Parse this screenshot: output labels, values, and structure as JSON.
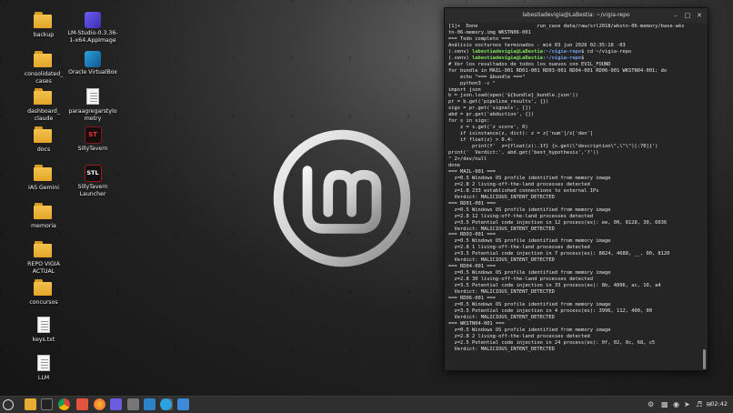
{
  "desktop": {
    "icons": [
      {
        "label": "backup",
        "icon": "folder-icon"
      },
      {
        "label": "consolidated_\ncases",
        "icon": "folder-icon"
      },
      {
        "label": "dashboard_\nclaude",
        "icon": "folder-icon"
      },
      {
        "label": "docs",
        "icon": "folder-icon"
      },
      {
        "label": "IAS Gemini",
        "icon": "folder-icon"
      },
      {
        "label": "memoria",
        "icon": "folder-icon"
      },
      {
        "label": "REPO VIGIA\nACTUAL",
        "icon": "folder-icon"
      },
      {
        "label": "concursos",
        "icon": "folder-icon"
      },
      {
        "label": "keys.txt",
        "icon": "text-file-icon"
      },
      {
        "label": "LLM",
        "icon": "shortcut-icon"
      },
      {
        "label": "LM-Studio-0.3.36-\n1-x64.AppImage",
        "icon": "lmstudio-icon"
      },
      {
        "label": "Oracle VirtualBox",
        "icon": "virtualbox-icon"
      },
      {
        "label": "paraagregarstylo\nmetry",
        "icon": "text-file-icon"
      },
      {
        "label": "SillyTavern",
        "icon": "sillytavern-icon"
      },
      {
        "label": "SillyTavern\nLauncher",
        "icon": "sillytavern-launcher-icon"
      }
    ]
  },
  "terminal": {
    "title": "labestiadevigia@LaBestia: ~/vigia-repo",
    "prompt_user": "labestiadevigia@LaBestia",
    "prompt_path": ":~/vigia-repo",
    "lines": [
      "[1]+  Done                    run_case data/raw/srl2018/wkstn-06-memory/base-wks",
      "tn-06-memory.img WKSTN06-001",
      "=== Todo completo ===",
      "Análisis nocturnos terminados - mié 03 jun 2026 02:35:18 -03",
      "",
      "",
      "# Ver los resultados de todos los nuevos con EVIL_FOUND",
      "for bundle in MAIL-001 RD01-001 RD03-001 RD04-001 RD06-001 WKSTN04-001; do",
      "    echo \"=== $bundle ===\"",
      "    python3 -c \"",
      "import json",
      "b = json.load(open('${bundle}_bundle.json'))",
      "pr = b.get('pipeline_results', {})",
      "sigs = pr.get('signals', [])",
      "abd = pr.get('abduction', {})",
      "for s in sigs:",
      "    z = s.get('z_score', 0)",
      "    if isinstance(z, dict): z = z['num']/z['den']",
      "    if float(z) > 0.4:",
      "        print(f'  z={float(z):.1f} {s.get(\\\"description\\\",\\\"\\\")[:70]}')",
      "print('  Verdict:', abd.get('best_hypothesis','?'))",
      "\" 2>/dev/null",
      "done",
      "=== MAIL-001 ===",
      "  z=0.5 Windows OS profile identified from memory image",
      "  z=2.8 2 living-off-the-land processes detected",
      "  z=1.8 233 established connections to external IPs",
      "  Verdict: MALICIOUS_INTENT_DETECTED",
      "=== RD01-001 ===",
      "  z=0.5 Windows OS profile identified from memory image",
      "  z=2.8 12 living-off-the-land processes detected",
      "  z=3.5 Potential code injection in 12 process(es): ee, 00, 8128, 30, 6036",
      "  Verdict: MALICIOUS_INTENT_DETECTED",
      "=== RD03-001 ===",
      "  z=0.5 Windows OS profile identified from memory image",
      "  z=2.8 1 living-off-the-land processes detected",
      "  z=3.5 Potential code injection in 7 process(es): 8824, 4688, __, 00, 8120",
      "  Verdict: MALICIOUS_INTENT_DETECTED",
      "=== RD04-001 ===",
      "  z=0.5 Windows OS profile identified from memory image",
      "  z=2.8 30 living-off-the-land processes detected",
      "  z=3.5 Potential code injection in 33 process(es): 8b, 4896, ac, 10, a4",
      "  Verdict: MALICIOUS_INTENT_DETECTED",
      "=== RD06-001 ===",
      "  z=0.5 Windows OS profile identified from memory image",
      "  z=3.5 Potential code injection in 4 process(es): 3996, 112, 400, 00",
      "  Verdict: MALICIOUS_INTENT_DETECTED",
      "=== WKSTN04-001 ===",
      "  z=0.5 Windows OS profile identified from memory image",
      "  z=2.8 2 living-off-the-land processes detected",
      "  z=2.5 Potential code injection in 24 process(es): 0f, 02, 0c, 68, c5",
      "  Verdict: MALICIOUS_INTENT_DETECTED",
      ""
    ],
    "prompt_lines": {
      "4": {
        "prefix": "(.venv) ",
        "cmd": "$ cd ~/vigia-repo"
      },
      "5": {
        "prefix": "(.venv) ",
        "cmd": "$ "
      },
      "54": {
        "prefix": "(.venv) ",
        "cmd": "$ "
      }
    }
  },
  "taskbar": {
    "apps": [
      "mint-menu-icon",
      "files-icon",
      "terminal-badge-icon",
      "chrome-icon",
      "brave-icon",
      "firefox-icon",
      "lmstudio-icon",
      "chromium-icon",
      "virtualbox-icon",
      "screenshot-icon",
      "telegram-icon",
      "notes-icon"
    ],
    "clock": "02:42"
  },
  "colors": {
    "prompt_user": "#7ddf5c",
    "prompt_path": "#6f9ee9",
    "terminal_bg": "#252525",
    "folder": "#f0b63c"
  }
}
